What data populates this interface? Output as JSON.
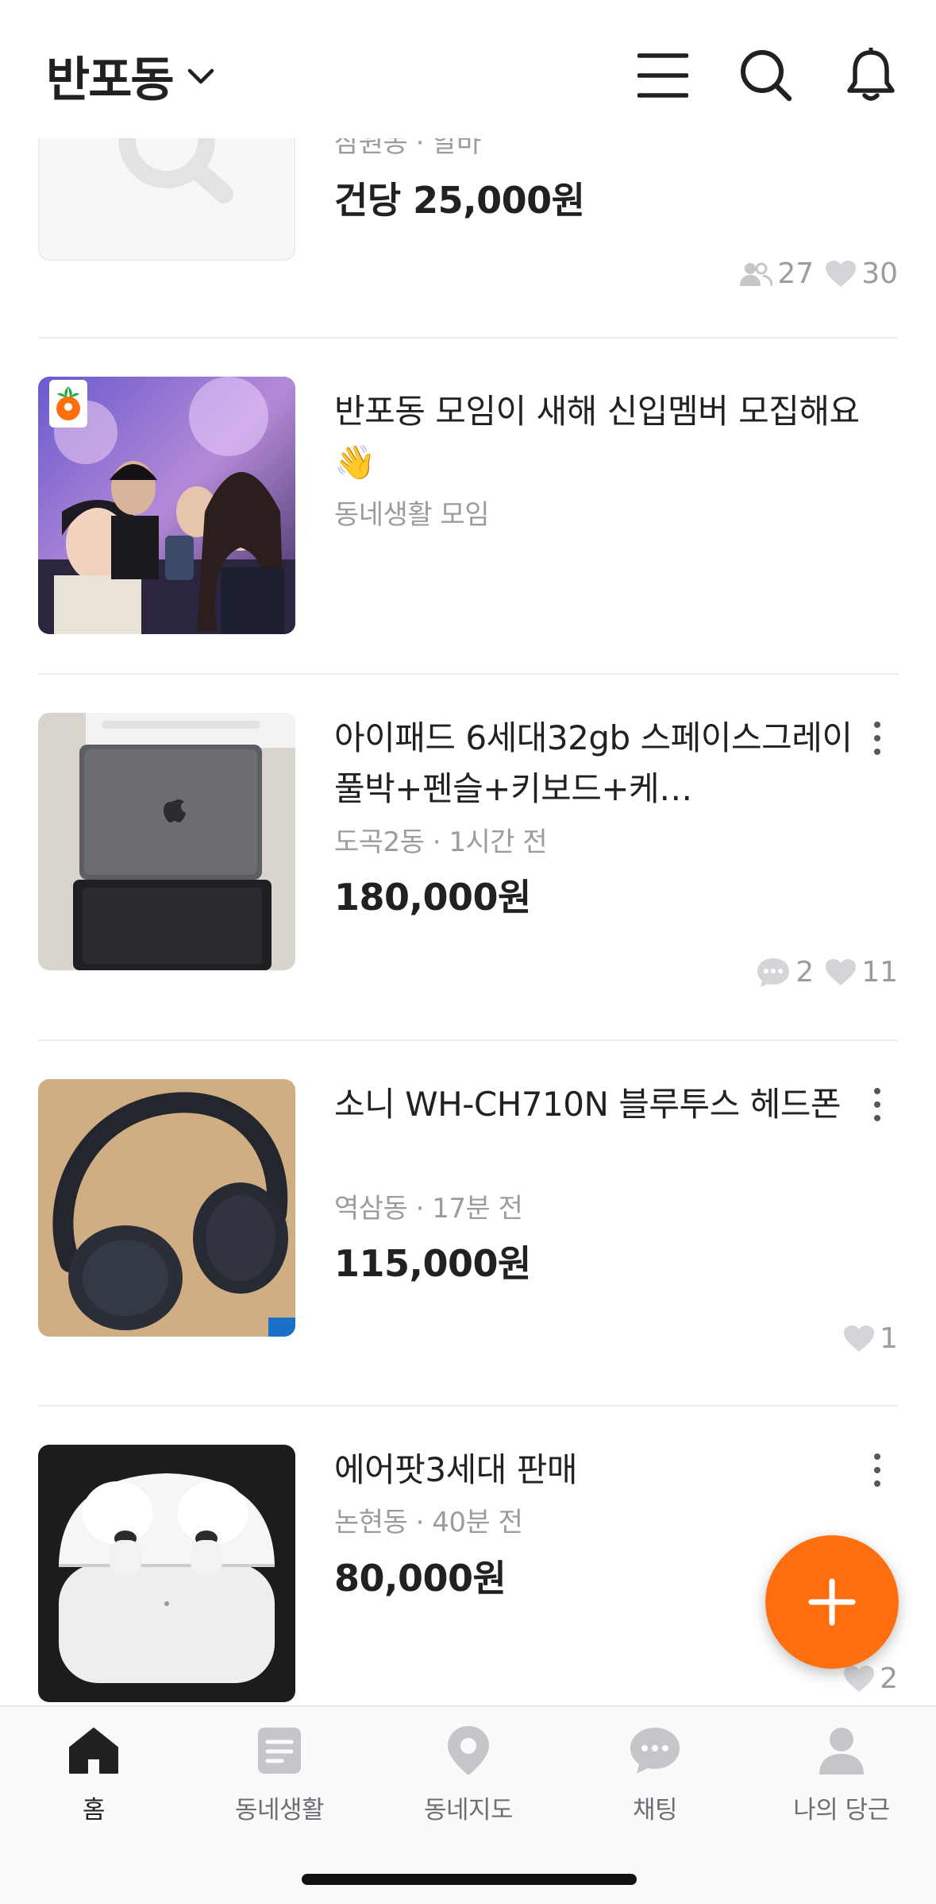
{
  "header": {
    "location": "반포동",
    "icons": [
      "menu-icon",
      "search-icon",
      "bell-icon"
    ]
  },
  "feed": {
    "items": [
      {
        "meta": "삼원동 · 알바",
        "price": "건당 25,000원",
        "stats": {
          "members": "27",
          "likes": "30"
        }
      },
      {
        "title": "반포동 모임이 새해 신입멤버 모집해요 👋",
        "meta": "동네생활 모임"
      },
      {
        "title": "아이패드 6세대32gb 스페이스그레이 풀박+펜슬+키보드+케…",
        "meta": "도곡2동 · 1시간 전",
        "price": "180,000원",
        "stats": {
          "chats": "2",
          "likes": "11"
        }
      },
      {
        "title": "소니 WH-CH710N 블루투스 헤드폰",
        "meta": "역삼동 · 17분 전",
        "price": "115,000원",
        "stats": {
          "likes": "1"
        }
      },
      {
        "title": "에어팟3세대 판매",
        "meta": "논현동 · 40분 전",
        "price": "80,000원",
        "stats": {
          "likes": "2"
        }
      }
    ]
  },
  "fab": {
    "icon": "plus-icon",
    "color": "#ff6f0f"
  },
  "tabbar": {
    "tabs": [
      {
        "label": "홈",
        "icon": "home-icon",
        "active": true
      },
      {
        "label": "동네생활",
        "icon": "community-icon"
      },
      {
        "label": "동네지도",
        "icon": "map-pin-icon"
      },
      {
        "label": "채팅",
        "icon": "chat-icon"
      },
      {
        "label": "나의 당근",
        "icon": "profile-icon"
      }
    ]
  },
  "colors": {
    "accent": "#ff6f0f",
    "text": "#212124",
    "subtext": "#9a9ca0",
    "divider": "#ececec"
  }
}
